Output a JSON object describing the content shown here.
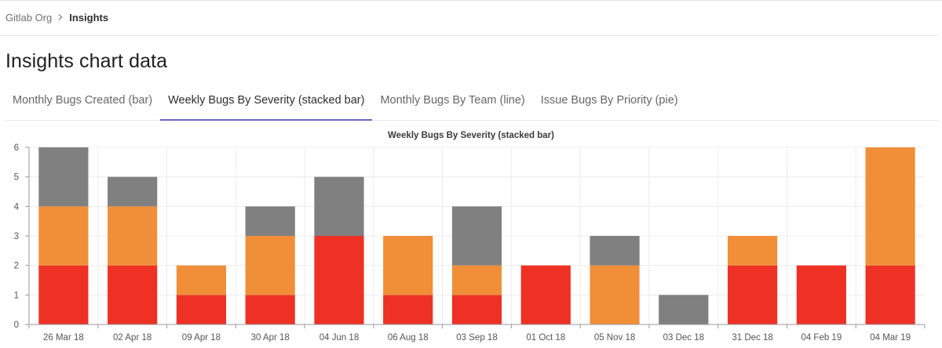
{
  "breadcrumb": {
    "parent": "Gitlab Org",
    "current": "Insights"
  },
  "page": {
    "title": "Insights chart data"
  },
  "tabs": [
    {
      "label": "Monthly Bugs Created (bar)",
      "active": false
    },
    {
      "label": "Weekly Bugs By Severity (stacked bar)",
      "active": true
    },
    {
      "label": "Monthly Bugs By Team (line)",
      "active": false
    },
    {
      "label": "Issue Bugs By Priority (pie)",
      "active": false
    }
  ],
  "icons": {
    "separator": "chevron-right-icon"
  },
  "colors": {
    "accent": "#6666c4"
  },
  "chart_data": {
    "type": "bar",
    "stacked": true,
    "title": "Weekly Bugs By Severity (stacked bar)",
    "categories": [
      "26 Mar 18",
      "02 Apr 18",
      "09 Apr 18",
      "30 Apr 18",
      "04 Jun 18",
      "06 Aug 18",
      "03 Sep 18",
      "01 Oct 18",
      "05 Nov 18",
      "03 Dec 18",
      "31 Dec 18",
      "04 Feb 19",
      "04 Mar 19"
    ],
    "series": [
      {
        "color": "#ee3124",
        "values": [
          2,
          2,
          1,
          1,
          3,
          1,
          1,
          2,
          0,
          0,
          2,
          2,
          2
        ]
      },
      {
        "color": "#f08f38",
        "values": [
          2,
          2,
          1,
          2,
          0,
          2,
          1,
          0,
          2,
          0,
          1,
          0,
          4
        ]
      },
      {
        "color": "#808080",
        "values": [
          2,
          1,
          0,
          1,
          2,
          0,
          2,
          0,
          1,
          1,
          0,
          0,
          0
        ]
      }
    ],
    "ylim": [
      0,
      6
    ],
    "yticks": [
      0,
      1,
      2,
      3,
      4,
      5,
      6
    ],
    "grid": true,
    "xlabel": "",
    "ylabel": ""
  }
}
